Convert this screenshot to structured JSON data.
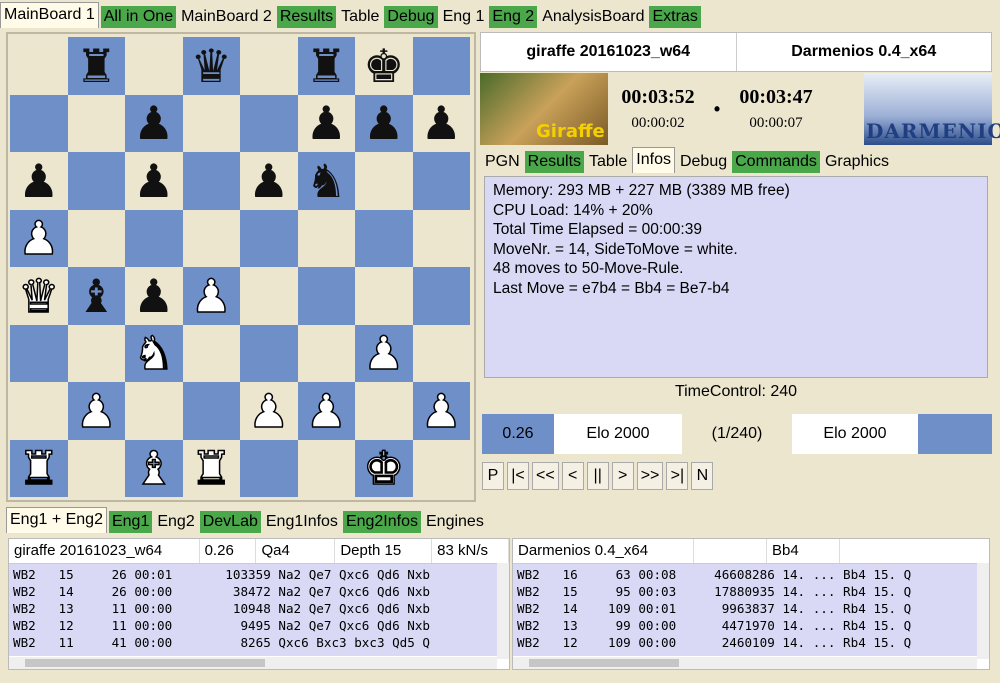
{
  "top_tabs": [
    {
      "label": "MainBoard 1",
      "style": "active"
    },
    {
      "label": "All in One",
      "style": "green"
    },
    {
      "label": "MainBoard 2",
      "style": "plain"
    },
    {
      "label": "Results",
      "style": "green"
    },
    {
      "label": "Table",
      "style": "plain"
    },
    {
      "label": "Debug",
      "style": "green"
    },
    {
      "label": "Eng 1",
      "style": "plain"
    },
    {
      "label": "Eng 2",
      "style": "green"
    },
    {
      "label": "AnalysisBoard",
      "style": "plain"
    },
    {
      "label": "Extras",
      "style": "green"
    }
  ],
  "board": {
    "rows": [
      [
        "",
        "br",
        "",
        "bq",
        "",
        "br",
        "bk",
        ""
      ],
      [
        "",
        "",
        "bp",
        "",
        "",
        "bp",
        "bp",
        "bp"
      ],
      [
        "bp",
        "",
        "bp",
        "",
        "bp",
        "bn",
        "",
        ""
      ],
      [
        "wp",
        "",
        "",
        "",
        "",
        "",
        "",
        ""
      ],
      [
        "wq",
        "bb",
        "bp",
        "wp",
        "",
        "",
        "",
        ""
      ],
      [
        "",
        "",
        "wn",
        "",
        "",
        "",
        "wp",
        ""
      ],
      [
        "",
        "wp",
        "",
        "",
        "wp",
        "wp",
        "",
        "wp"
      ],
      [
        "wr",
        "",
        "wb",
        "wr",
        "",
        "",
        "wk",
        ""
      ]
    ],
    "light_color": "#ece6cf",
    "dark_color": "#6f8fc9"
  },
  "players": {
    "white": "giraffe 20161023_w64",
    "black": "Darmenios 0.4_x64"
  },
  "clocks": {
    "white_main": "00:03:52",
    "white_sub": "00:00:02",
    "separator": "•",
    "black_main": "00:03:47",
    "black_sub": "00:00:07"
  },
  "logos": {
    "white_text": "Giraffe",
    "black_text": "DARMENIOS"
  },
  "info_tabs": [
    {
      "label": "PGN",
      "style": "plain"
    },
    {
      "label": "Results",
      "style": "green"
    },
    {
      "label": "Table",
      "style": "plain"
    },
    {
      "label": "Infos",
      "style": "active"
    },
    {
      "label": "Debug",
      "style": "plain"
    },
    {
      "label": "Commands",
      "style": "green"
    },
    {
      "label": "Graphics",
      "style": "plain"
    }
  ],
  "infos": [
    "Memory: 293 MB + 227 MB (3389 MB free)",
    "CPU Load: 14% + 20%",
    "Total Time Elapsed = 00:00:39",
    "MoveNr. = 14, SideToMove = white.",
    "48 moves to 50-Move-Rule.",
    "Last Move = e7b4 = Bb4 = Be7-b4"
  ],
  "time_control": "TimeControl: 240",
  "elo_row": {
    "eval": "0.26",
    "white_elo": "Elo 2000",
    "match": "(1/240)",
    "black_elo": "Elo 2000"
  },
  "nav_buttons": [
    "P",
    "|<",
    "<<",
    "<",
    "||",
    ">",
    ">>",
    ">|",
    "N"
  ],
  "bottom_tabs": [
    {
      "label": "Eng1 + Eng2",
      "style": "active"
    },
    {
      "label": "Eng1",
      "style": "green"
    },
    {
      "label": "Eng2",
      "style": "plain"
    },
    {
      "label": "DevLab",
      "style": "green"
    },
    {
      "label": "Eng1Infos",
      "style": "plain"
    },
    {
      "label": "Eng2Infos",
      "style": "green"
    },
    {
      "label": "Engines",
      "style": "plain"
    }
  ],
  "engine1": {
    "name": "giraffe 20161023_w64",
    "eval": "0.26",
    "bestmove": "Qa4",
    "depth": "Depth 15",
    "speed": "83 kN/s",
    "lines": [
      "WB2   15     26 00:01       103359 Na2 Qe7 Qxc6 Qd6 Nxb",
      "WB2   14     26 00:00        38472 Na2 Qe7 Qxc6 Qd6 Nxb",
      "WB2   13     11 00:00        10948 Na2 Qe7 Qxc6 Qd6 Nxb",
      "WB2   12     11 00:00         9495 Na2 Qe7 Qxc6 Qd6 Nxb",
      "WB2   11     41 00:00         8265 Qxc6 Bxc3 bxc3 Qd5 Q"
    ]
  },
  "engine2": {
    "name": "Darmenios 0.4_x64",
    "bestmove": "Bb4",
    "lines": [
      "WB2   16     63 00:08     46608286 14. ... Bb4 15. Q",
      "WB2   15     95 00:03     17880935 14. ... Rb4 15. Q",
      "WB2   14    109 00:01      9963837 14. ... Rb4 15. Q",
      "WB2   13     99 00:00      4471970 14. ... Rb4 15. Q",
      "WB2   12    109 00:00      2460109 14. ... Rb4 15. Q"
    ]
  }
}
